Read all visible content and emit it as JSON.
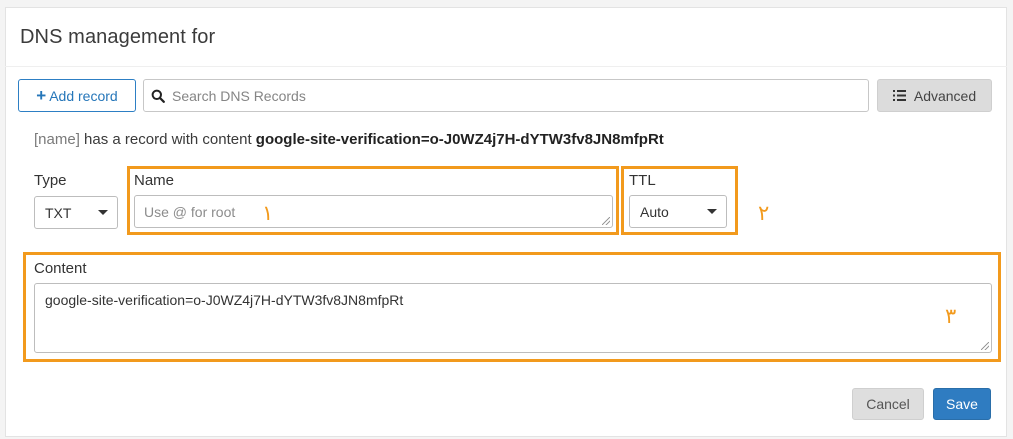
{
  "header": {
    "title": "DNS management for"
  },
  "toolbar": {
    "add_record_label": "Add record",
    "add_record_icon": "plus-icon",
    "search_placeholder": "Search DNS Records",
    "search_icon": "search-icon",
    "advanced_label": "Advanced",
    "advanced_icon": "list-icon"
  },
  "info": {
    "name_token": "[name]",
    "middle_text": "has a record with content",
    "content_value": "google-site-verification=o-J0WZ4j7H-dYTW3fv8JN8mfpRt"
  },
  "form": {
    "type": {
      "label": "Type",
      "value": "TXT"
    },
    "name": {
      "label": "Name",
      "placeholder": "Use @ for root",
      "value": ""
    },
    "ttl": {
      "label": "TTL",
      "value": "Auto"
    },
    "content": {
      "label": "Content",
      "value": "google-site-verification=o-J0WZ4j7H-dYTW3fv8JN8mfpRt"
    }
  },
  "annotations": {
    "highlight_color": "#f29a1d",
    "step_1": "۱",
    "step_2": "۲",
    "step_3": "۳"
  },
  "actions": {
    "cancel_label": "Cancel",
    "save_label": "Save"
  },
  "colors": {
    "primary": "#2f7cc1",
    "accent_border": "#2d7fc4"
  }
}
